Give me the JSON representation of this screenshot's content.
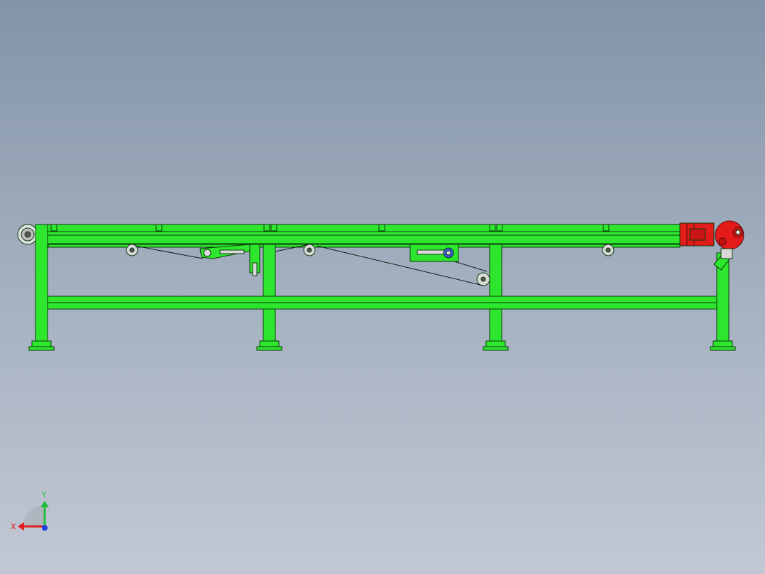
{
  "viewport": {
    "background_top": "#8393a8",
    "background_bottom": "#c2c8d3"
  },
  "model": {
    "frame_color": "#2ee62e",
    "outline_color": "#0b3d0b",
    "motor_color": "#e31b1b",
    "roller_color": "#d9d9d9"
  },
  "triad": {
    "x_label": "X",
    "y_label": "Y",
    "x_color": "#e11d1d",
    "y_color": "#1fbf3a",
    "z_color": "#1d3fe1"
  }
}
